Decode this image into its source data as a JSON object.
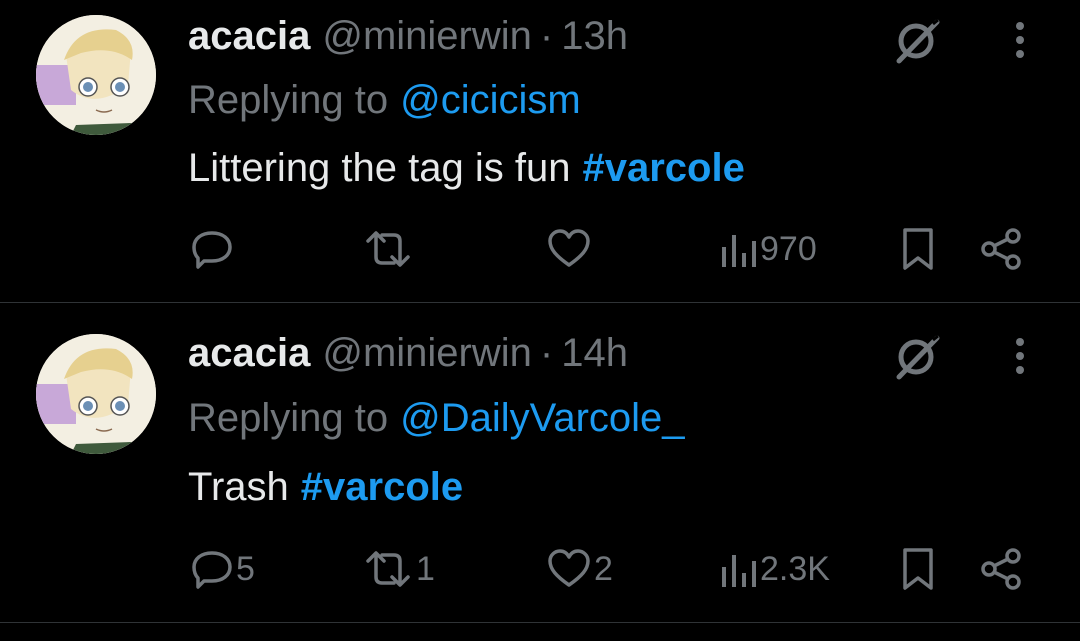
{
  "tweets": [
    {
      "display_name": "acacia",
      "handle": "@minierwin",
      "separator": "·",
      "time": "13h",
      "replying_to_prefix": "Replying to",
      "replying_to_handle": "@cicicism",
      "text": "Littering the tag is fun",
      "hashtag": "#varcole",
      "replies": "",
      "retweets": "",
      "likes": "",
      "views": "970"
    },
    {
      "display_name": "acacia",
      "handle": "@minierwin",
      "separator": "·",
      "time": "14h",
      "replying_to_prefix": "Replying to",
      "replying_to_handle": "@DailyVarcole_",
      "text": "Trash",
      "hashtag": "#varcole",
      "replies": "5",
      "retweets": "1",
      "likes": "2",
      "views": "2.3K"
    }
  ],
  "icons": {
    "grok": "grok-icon",
    "more": "more-vertical-icon",
    "reply": "reply-icon",
    "retweet": "retweet-icon",
    "like": "heart-icon",
    "views": "views-bar-chart-icon",
    "bookmark": "bookmark-icon",
    "share": "share-icon"
  },
  "colors": {
    "background": "#000000",
    "primary_text": "#e7e9ea",
    "secondary_text": "#71767b",
    "accent": "#1d9bf0",
    "divider": "#2f3336"
  }
}
